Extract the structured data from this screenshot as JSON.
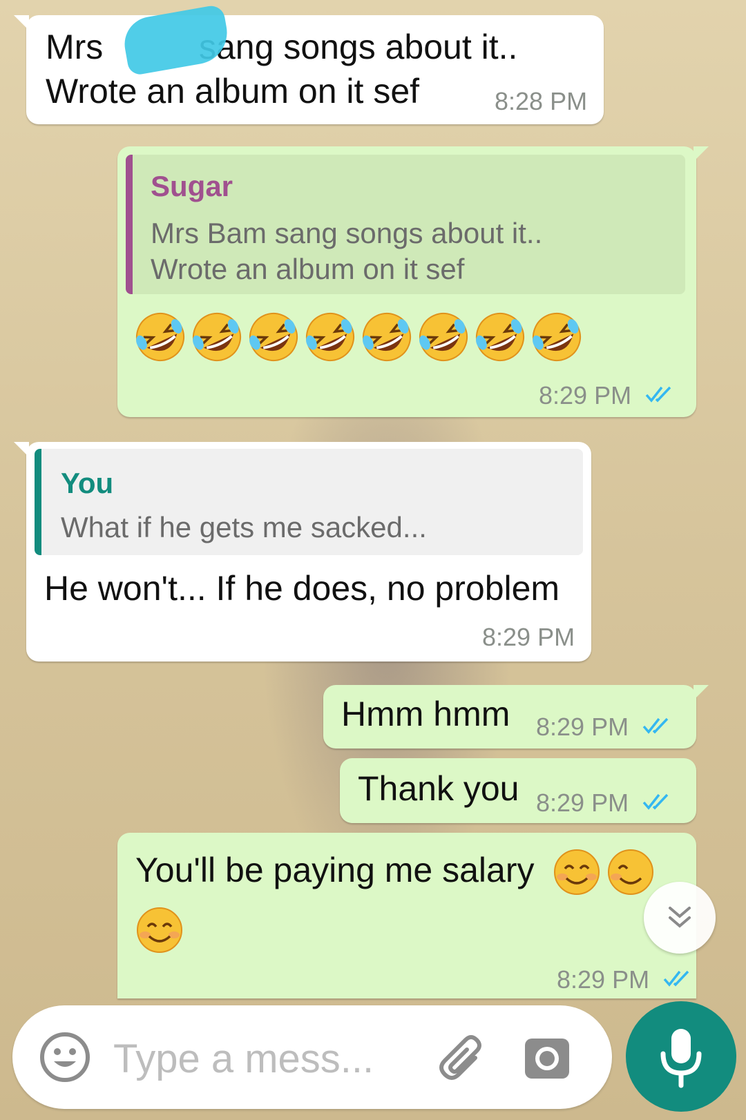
{
  "messages": [
    {
      "dir": "in",
      "lines": [
        "Mrs",
        "sang songs about it..",
        "Wrote an album on it sef"
      ],
      "time": "8:28 PM"
    },
    {
      "dir": "out",
      "quote": {
        "name": "Sugar",
        "lines": [
          "Mrs Bam sang songs about it..",
          "Wrote an album on it sef"
        ]
      },
      "emoji": "rolling-on-floor-laughing-emoji",
      "emoji_count": 8,
      "time": "8:29 PM"
    },
    {
      "dir": "in",
      "quote": {
        "name": "You",
        "text": "What if he gets me sacked..."
      },
      "text": "He won't... If he does, no problem",
      "time": "8:29 PM"
    },
    {
      "dir": "out",
      "text": "Hmm hmm",
      "time": "8:29 PM"
    },
    {
      "dir": "out",
      "text": "Thank you",
      "time": "8:29 PM"
    },
    {
      "dir": "out",
      "text": "You'll be paying me salary",
      "emoji": "smiling-face-emoji",
      "emoji_count": 3,
      "time": "8:29 PM"
    }
  ],
  "composer": {
    "placeholder": "Type a mess..."
  },
  "colors": {
    "incoming_bubble": "#ffffff",
    "outgoing_bubble": "#dcf8c6",
    "quote_sugar_name": "#a0508f",
    "quote_you_name": "#128c7e",
    "read_ticks": "#34b7f1",
    "mic_button": "#128c7e"
  },
  "icons": [
    "emoji-icon",
    "attach-icon",
    "camera-icon",
    "mic-icon",
    "scroll-down-icon",
    "read-ticks-icon"
  ]
}
